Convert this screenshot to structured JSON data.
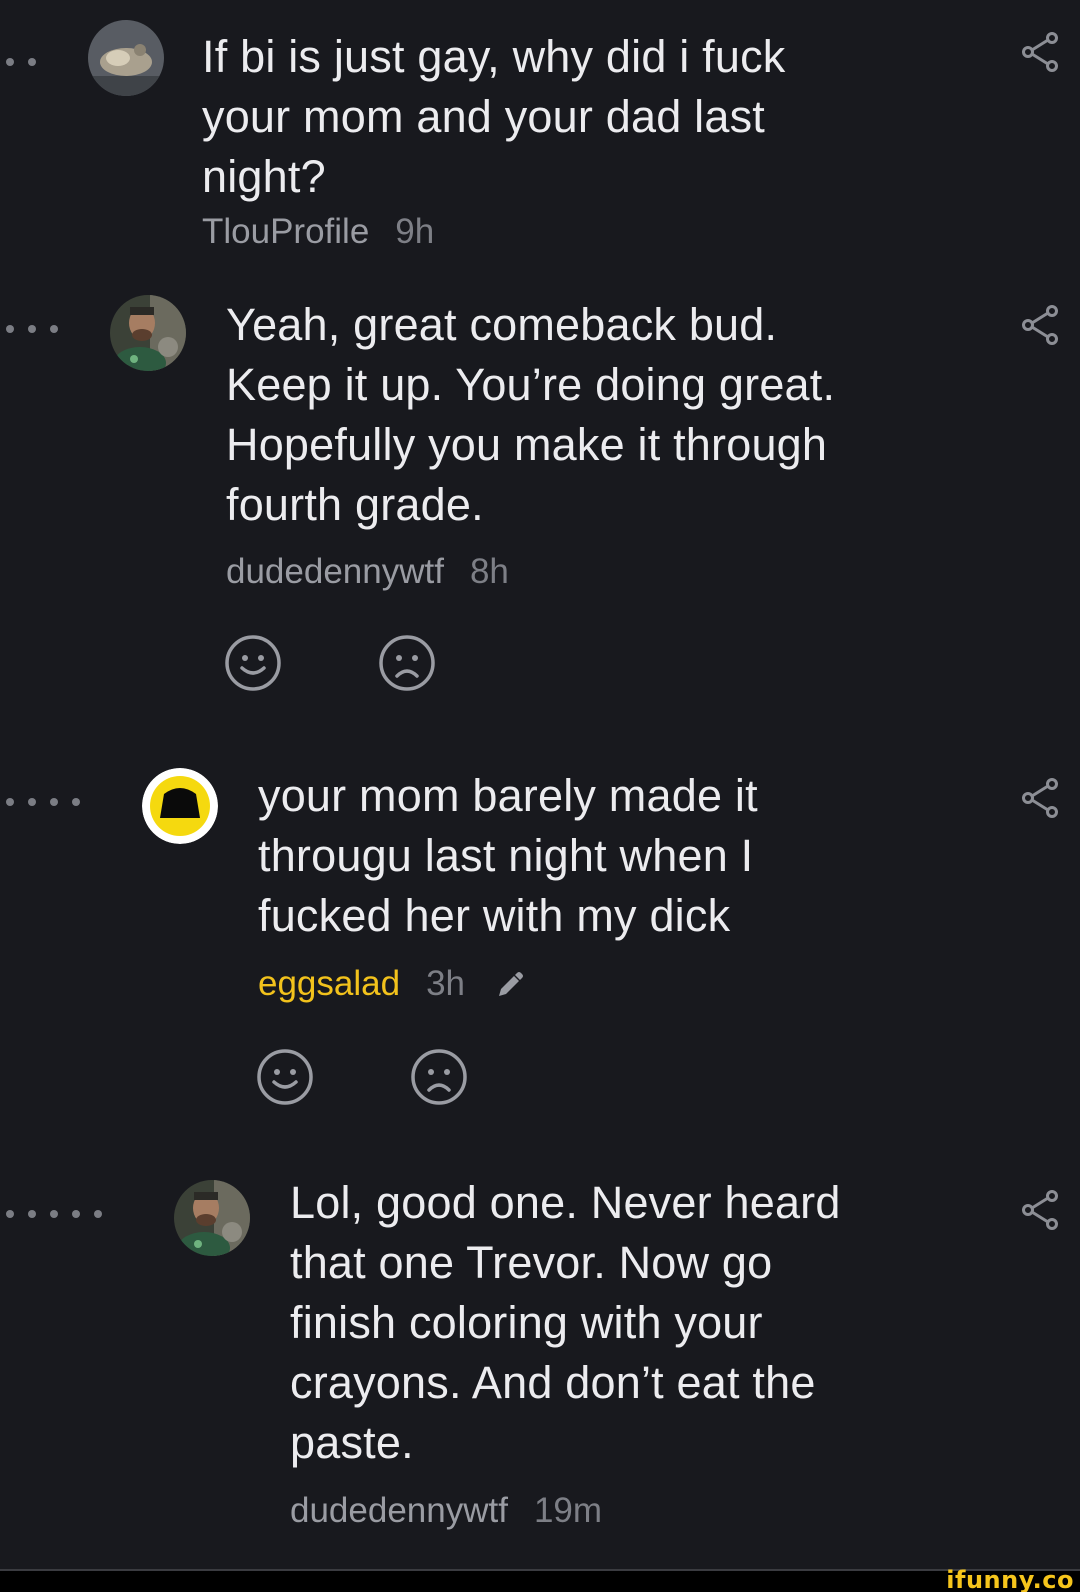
{
  "comments": [
    {
      "text": "If bi is just gay, why did i fuck\nyour mom and your dad last\nnight?",
      "author": "TlouProfile",
      "time": "9h",
      "depth": 2
    },
    {
      "text": "Yeah, great comeback bud.\nKeep it up. You’re doing great.\nHopefully you make it through\nfourth grade.",
      "author": "dudedennywtf",
      "time": "8h",
      "depth": 3
    },
    {
      "text": "your mom barely made it\nthrougu last night when I\nfucked her with my dick",
      "author": "eggsalad",
      "time": "3h",
      "edited": true,
      "depth": 4
    },
    {
      "text": "Lol, good one. Never heard\nthat one Trevor. Now go\nfinish coloring with your\ncrayons. And don’t eat the\npaste.",
      "author": "dudedennywtf",
      "time": "19m",
      "depth": 5
    }
  ],
  "icons": {
    "share": "share-icon",
    "like": "smile-icon",
    "dislike": "frown-icon",
    "edit": "pencil-icon"
  },
  "colors": {
    "background": "#18191e",
    "text": "#ececef",
    "meta": "#9a9ca3",
    "highlight_author": "#f2c21c"
  },
  "footer": {
    "brand": "ifunny.co"
  }
}
